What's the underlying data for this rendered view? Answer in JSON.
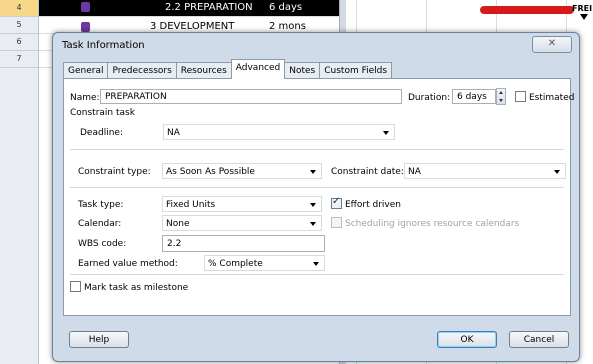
{
  "background": {
    "row_numbers": [
      "4",
      "5",
      "6",
      "7"
    ],
    "rows": [
      {
        "name": "2.2 PREPARATION",
        "duration": "6 days"
      },
      {
        "name": "3 DEVELOPMENT",
        "duration": "2 mons"
      }
    ],
    "gantt_label": "FREI"
  },
  "dialog": {
    "title": "Task Information",
    "close_label": "✕",
    "tabs": [
      "General",
      "Predecessors",
      "Resources",
      "Advanced",
      "Notes",
      "Custom Fields"
    ],
    "active_tab": "Advanced",
    "name": {
      "label": "Name:",
      "value": "PREPARATION"
    },
    "duration": {
      "label": "Duration:",
      "value": "6 days"
    },
    "estimated": {
      "label": "Estimated",
      "checked": false
    },
    "constrain_task": "Constrain task",
    "deadline": {
      "label": "Deadline:",
      "value": "NA"
    },
    "constraint_type": {
      "label": "Constraint type:",
      "value": "As Soon As Possible"
    },
    "constraint_date": {
      "label": "Constraint date:",
      "value": "NA"
    },
    "task_type": {
      "label": "Task type:",
      "value": "Fixed Units"
    },
    "effort_driven": {
      "label": "Effort driven",
      "checked": true
    },
    "calendar": {
      "label": "Calendar:",
      "value": "None"
    },
    "scheduling_ignores": {
      "label": "Scheduling ignores resource calendars",
      "checked": false,
      "disabled": true
    },
    "wbs_code": {
      "label": "WBS code:",
      "value": "2.2"
    },
    "earned_value": {
      "label": "Earned value method:",
      "value": "% Complete"
    },
    "milestone": {
      "label": "Mark task as milestone",
      "checked": false
    },
    "help_button": "Help",
    "ok_button": "OK",
    "cancel_button": "Cancel"
  },
  "colors": {
    "dialog_bg": "#cfdbe9",
    "gantt_bar": "#d51a1a",
    "selected_row": "#000000"
  }
}
